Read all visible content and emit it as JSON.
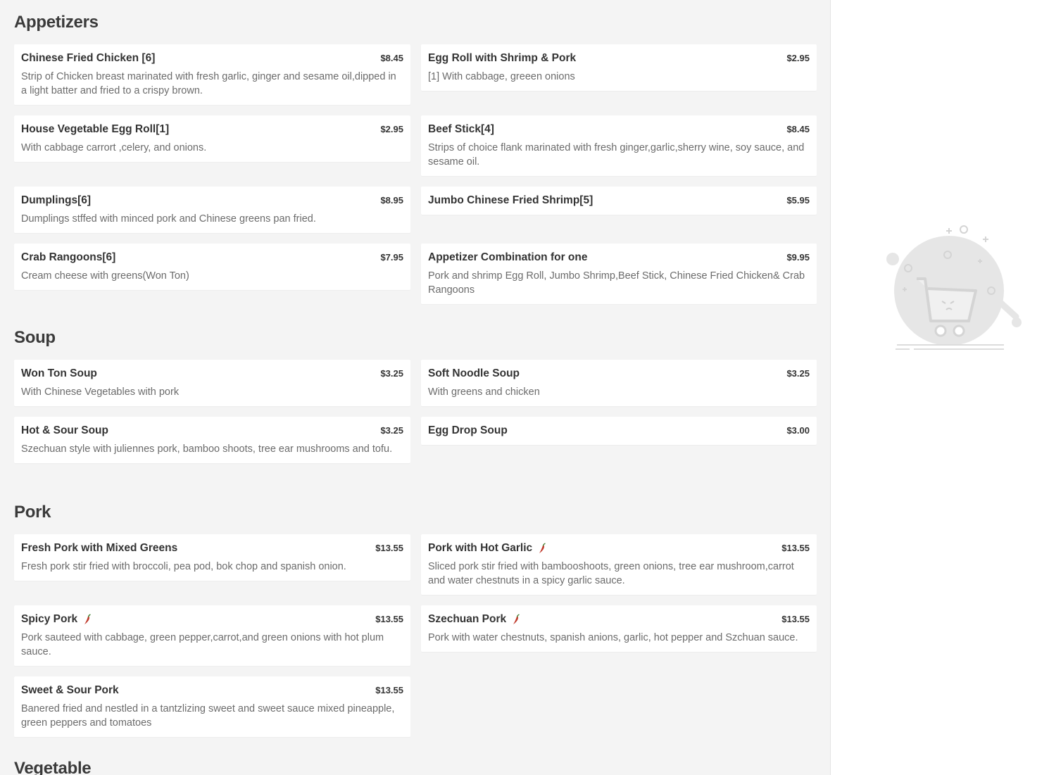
{
  "categories": [
    {
      "title": "Appetizers",
      "items": [
        {
          "name": "Chinese Fried Chicken [6]",
          "price": "$8.45",
          "desc": "Strip of Chicken breast marinated with fresh garlic, ginger and sesame oil,dipped in a light batter and fried to a crispy brown.",
          "spicy": false
        },
        {
          "name": "Egg Roll with Shrimp & Pork",
          "price": "$2.95",
          "desc": "[1] With cabbage, greeen onions",
          "spicy": false
        },
        {
          "name": "House Vegetable Egg Roll[1]",
          "price": "$2.95",
          "desc": "With cabbage carrort ,celery, and onions.",
          "spicy": false
        },
        {
          "name": "Beef Stick[4]",
          "price": "$8.45",
          "desc": "Strips of choice flank marinated with fresh ginger,garlic,sherry wine, soy sauce, and sesame oil.",
          "spicy": false
        },
        {
          "name": "Dumplings[6]",
          "price": "$8.95",
          "desc": "Dumplings stffed with minced pork and Chinese greens pan fried.",
          "spicy": false
        },
        {
          "name": "Jumbo Chinese Fried Shrimp[5]",
          "price": "$5.95",
          "desc": "",
          "spicy": false
        },
        {
          "name": "Crab Rangoons[6]",
          "price": "$7.95",
          "desc": "Cream cheese with greens(Won Ton)",
          "spicy": false
        },
        {
          "name": "Appetizer Combination for one",
          "price": "$9.95",
          "desc": "Pork and shrimp Egg Roll, Jumbo Shrimp,Beef Stick, Chinese Fried Chicken& Crab Rangoons",
          "spicy": false
        }
      ]
    },
    {
      "title": "Soup",
      "items": [
        {
          "name": "Won Ton Soup",
          "price": "$3.25",
          "desc": "With Chinese Vegetables with pork",
          "spicy": false
        },
        {
          "name": "Soft Noodle Soup",
          "price": "$3.25",
          "desc": "With greens and chicken",
          "spicy": false
        },
        {
          "name": "Hot & Sour Soup",
          "price": "$3.25",
          "desc": "Szechuan style with juliennes pork, bamboo shoots, tree ear mushrooms and tofu.",
          "spicy": false
        },
        {
          "name": "Egg Drop Soup",
          "price": "$3.00",
          "desc": "",
          "spicy": false
        }
      ]
    },
    {
      "title": "Pork",
      "items": [
        {
          "name": "Fresh Pork with Mixed Greens",
          "price": "$13.55",
          "desc": "Fresh pork stir fried with broccoli, pea pod, bok chop and spanish onion.",
          "spicy": false
        },
        {
          "name": "Pork with Hot Garlic",
          "price": "$13.55",
          "desc": "Sliced pork stir fried with bambooshoots, green onions, tree ear mushroom,carrot and water chestnuts in a spicy garlic sauce.",
          "spicy": true
        },
        {
          "name": "Spicy Pork",
          "price": "$13.55",
          "desc": "Pork sauteed with cabbage, green pepper,carrot,and green onions with hot plum sauce.",
          "spicy": true
        },
        {
          "name": "Szechuan Pork",
          "price": "$13.55",
          "desc": "Pork with water chestnuts, spanish anions, garlic, hot pepper and Szchuan sauce.",
          "spicy": true
        },
        {
          "name": "Sweet & Sour Pork",
          "price": "$13.55",
          "desc": "Banered fried and nestled in a tantzlizing sweet and sweet sauce mixed pineapple, green peppers and tomatoes",
          "spicy": false
        }
      ]
    },
    {
      "title": "Vegetable",
      "items": []
    }
  ],
  "side_panel": {
    "illustration": "empty-cart-icon"
  },
  "colors": {
    "background": "#f4f4f4",
    "card": "#ffffff",
    "chili": "#c0392b"
  }
}
